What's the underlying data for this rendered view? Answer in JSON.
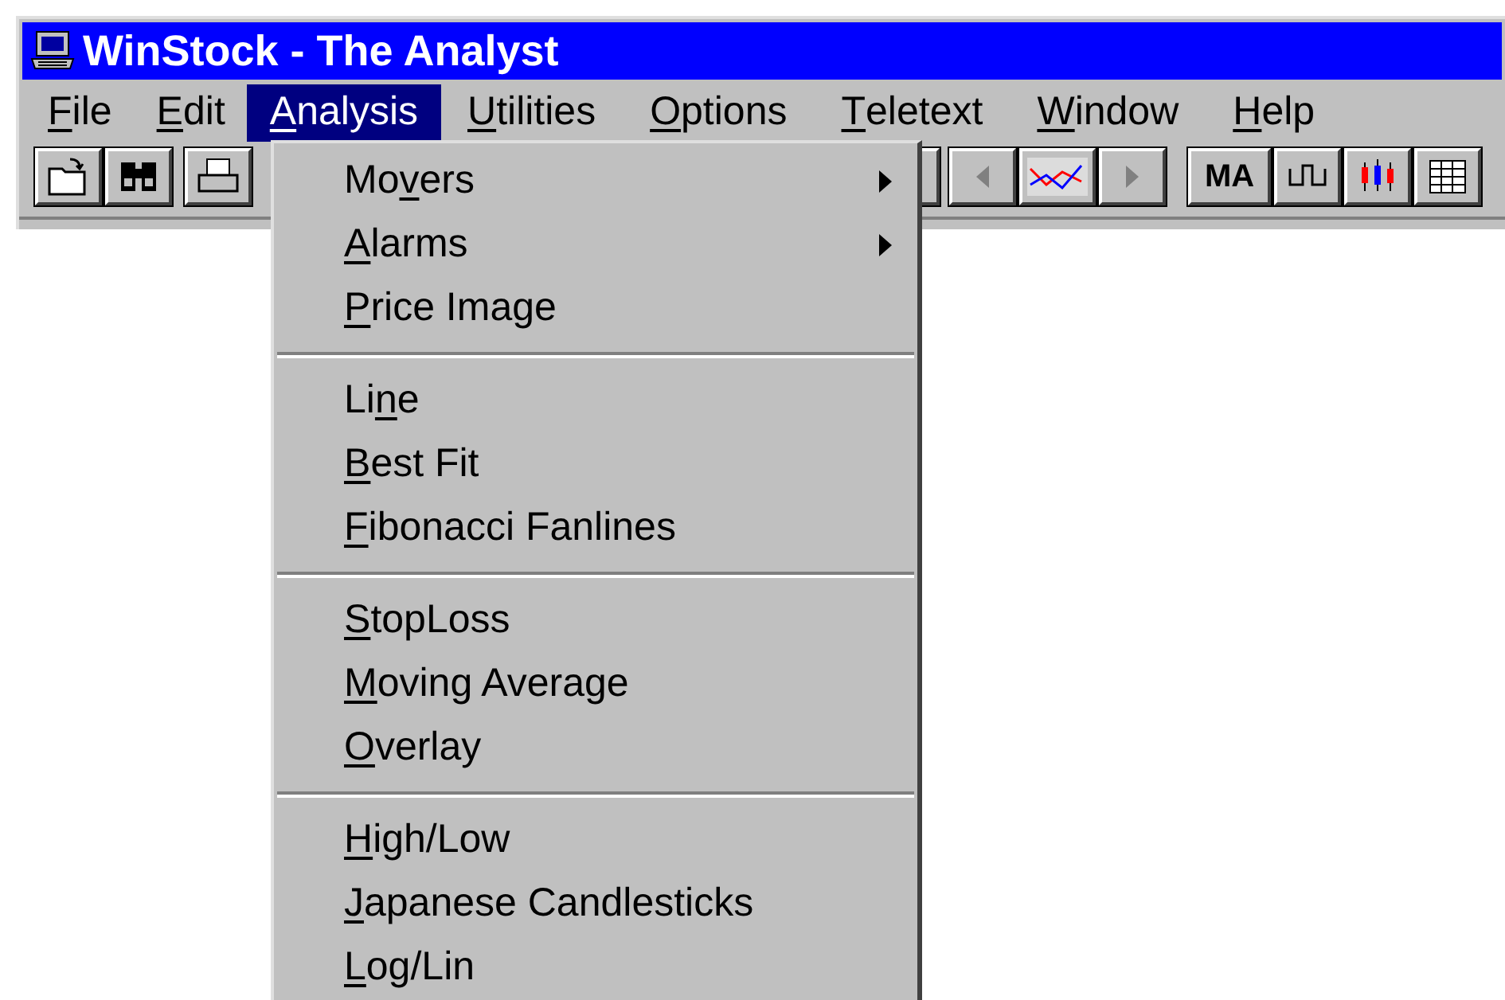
{
  "window": {
    "title": "WinStock - The Analyst"
  },
  "menu_bar": [
    {
      "key": "F",
      "after": "ile",
      "selected": false
    },
    {
      "key": "E",
      "after": "dit",
      "selected": false
    },
    {
      "key": "A",
      "after": "nalysis",
      "selected": true
    },
    {
      "key": "U",
      "after": "tilities",
      "selected": false
    },
    {
      "key": "O",
      "after": "ptions",
      "selected": false
    },
    {
      "key": "T",
      "after": "eletext",
      "selected": false
    },
    {
      "key": "W",
      "after": "indow",
      "selected": false
    },
    {
      "key": "H",
      "after": "elp",
      "selected": false
    }
  ],
  "toolbar": [
    {
      "kind": "open"
    },
    {
      "kind": "find"
    },
    {
      "kind": "print"
    },
    {
      "kind": "partial"
    },
    {
      "kind": "left"
    },
    {
      "kind": "chart"
    },
    {
      "kind": "right"
    },
    {
      "kind": "text",
      "label": "MA"
    },
    {
      "kind": "step"
    },
    {
      "kind": "candles"
    },
    {
      "kind": "grid"
    }
  ],
  "dropdown": [
    [
      {
        "before": "Mo",
        "key": "v",
        "after": "ers",
        "submenu": true
      },
      {
        "key": "A",
        "after": "larms",
        "submenu": true
      },
      {
        "key": "P",
        "after": "rice Image",
        "submenu": false
      }
    ],
    [
      {
        "before": "Li",
        "key": "n",
        "after": "e",
        "submenu": false
      },
      {
        "key": "B",
        "after": "est Fit",
        "submenu": false
      },
      {
        "key": "F",
        "after": "ibonacci Fanlines",
        "submenu": false
      }
    ],
    [
      {
        "key": "S",
        "after": "topLoss",
        "submenu": false
      },
      {
        "key": "M",
        "after": "oving Average",
        "submenu": false
      },
      {
        "key": "O",
        "after": "verlay",
        "submenu": false
      }
    ],
    [
      {
        "key": "H",
        "after": "igh/Low",
        "submenu": false
      },
      {
        "key": "J",
        "after": "apanese Candlesticks",
        "submenu": false
      },
      {
        "key": "L",
        "after": "og/Lin",
        "submenu": false
      }
    ]
  ]
}
